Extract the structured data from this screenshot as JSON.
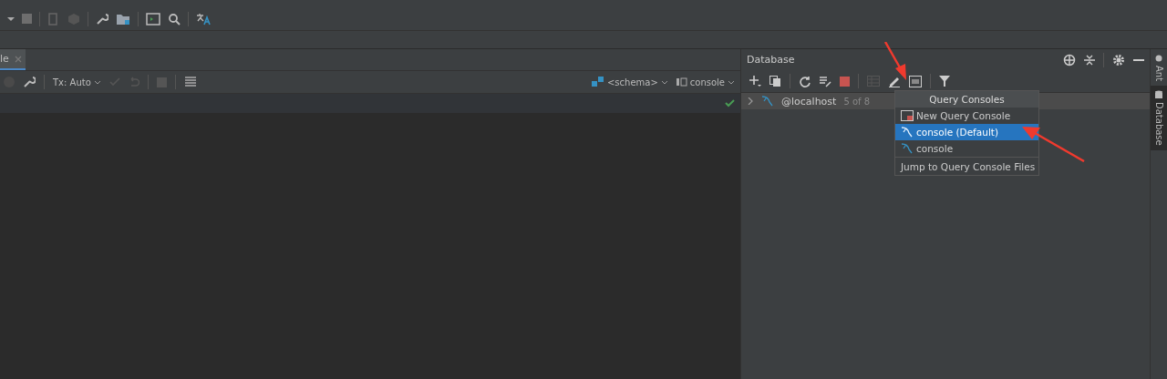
{
  "editor_tab": {
    "label": "le",
    "selected": true
  },
  "editor_toolbar": {
    "tx_mode": "Tx: Auto",
    "schema": "<schema>",
    "console": "console"
  },
  "database_panel": {
    "title": "Database",
    "tree": [
      {
        "name": "@localhost",
        "count": "5 of 8",
        "expanded": false
      }
    ]
  },
  "popup": {
    "title": "Query Consoles",
    "items": [
      {
        "kind": "new",
        "label": "New Query Console",
        "selected": false
      },
      {
        "kind": "console",
        "label": "console (Default)",
        "selected": true
      },
      {
        "kind": "console",
        "label": "console",
        "selected": false
      },
      {
        "kind": "jump",
        "label": "Jump to Query Console Files",
        "selected": false
      }
    ]
  },
  "side_tabs": [
    {
      "label": "Ant",
      "selected": false
    },
    {
      "label": "Database",
      "selected": true
    }
  ]
}
